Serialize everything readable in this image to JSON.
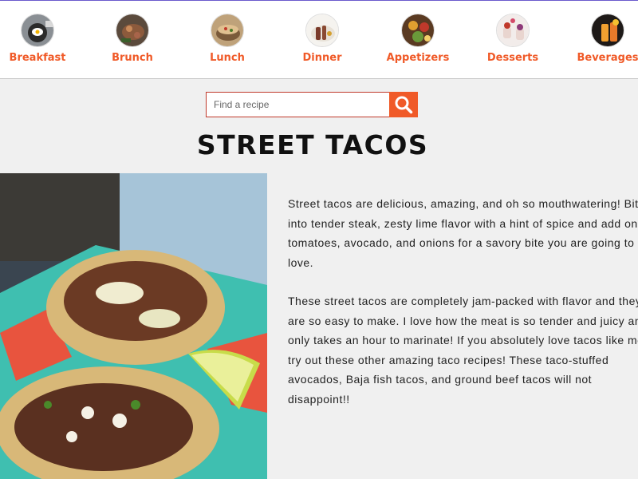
{
  "categories": [
    {
      "label": "Breakfast",
      "icon": "breakfast-icon"
    },
    {
      "label": "Brunch",
      "icon": "brunch-icon"
    },
    {
      "label": "Lunch",
      "icon": "lunch-icon"
    },
    {
      "label": "Dinner",
      "icon": "dinner-icon"
    },
    {
      "label": "Appetizers",
      "icon": "appetizers-icon"
    },
    {
      "label": "Desserts",
      "icon": "desserts-icon"
    },
    {
      "label": "Beverages",
      "icon": "beverages-icon"
    }
  ],
  "search": {
    "placeholder": "Find a recipe",
    "icon": "search-icon"
  },
  "recipe": {
    "title": "STREET TACOS",
    "paragraphs": [
      "Street tacos are delicious, amazing, and oh so mouthwatering! Bite into tender steak, zesty lime flavor with a hint of spice and add on tomatoes, avocado, and onions for a savory bite you are going to love.",
      "These street tacos are completely jam-packed with flavor and they are so easy to make. I love how the meat is so tender and juicy and only takes an hour to marinate! If you absolutely love tacos like me, try out these other amazing taco recipes! These taco-stuffed avocados, Baja fish tacos, and ground beef tacos will not disappoint!!"
    ]
  },
  "colors": {
    "accent": "#f05a28",
    "search_border": "#c0392b",
    "background": "#f0f0f0"
  }
}
